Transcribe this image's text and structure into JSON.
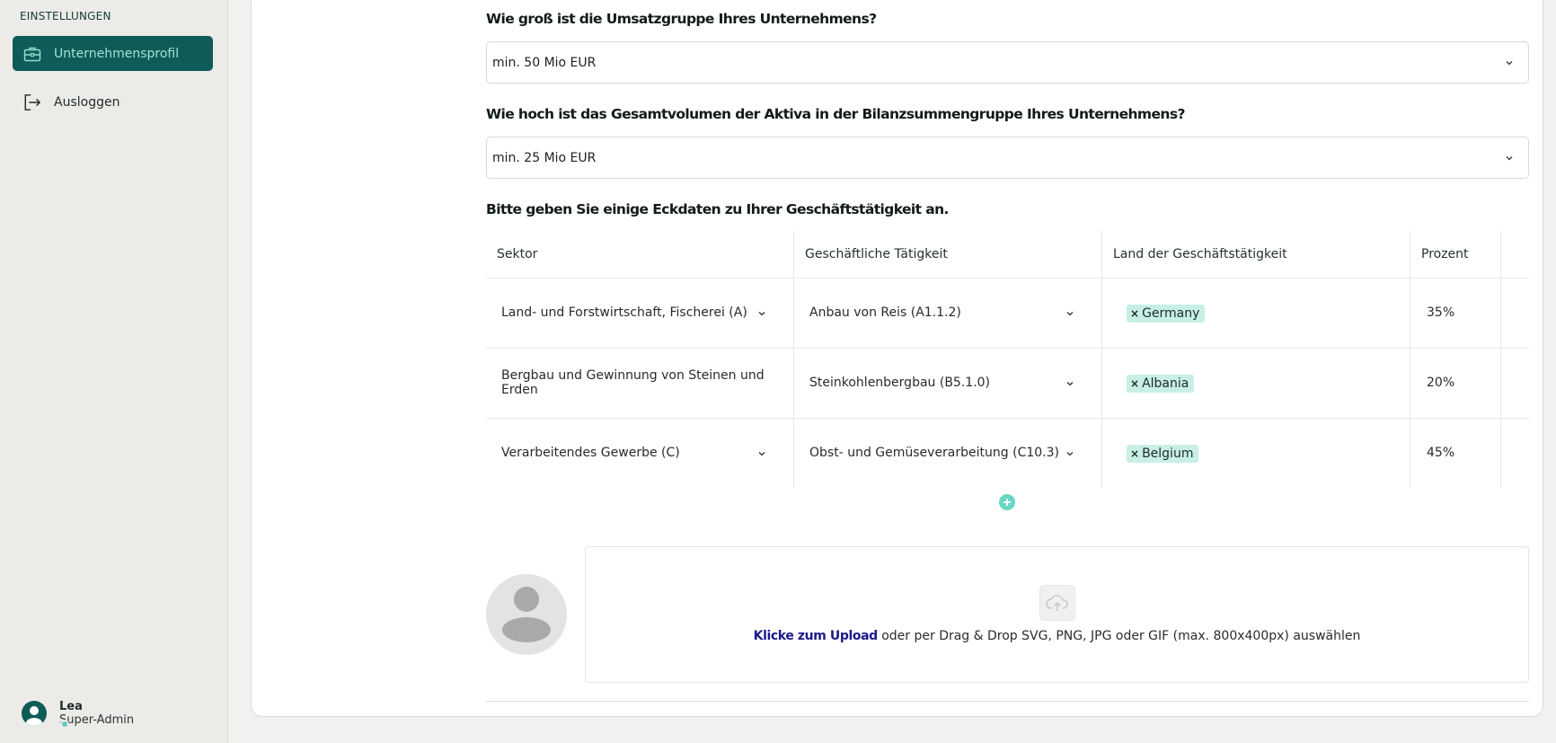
{
  "sidebar": {
    "section_title": "EINSTELLUNGEN",
    "items": [
      {
        "label": "Unternehmensprofil",
        "icon": "briefcase-icon",
        "active": true
      },
      {
        "label": "Ausloggen",
        "icon": "logout-icon",
        "active": false
      }
    ],
    "user": {
      "name": "Lea",
      "role": "Super-Admin"
    }
  },
  "form": {
    "q1": {
      "label": "Wie groß ist die Umsatzgruppe Ihres Unternehmens?",
      "value": "min. 50 Mio EUR"
    },
    "q2": {
      "label": "Wie hoch ist das Gesamtvolumen der Aktiva in der Bilanzsummengruppe Ihres Unternehmens?",
      "value": "min. 25 Mio EUR"
    },
    "q3": {
      "label": "Bitte geben Sie einige Eckdaten zu Ihrer Geschäftstätigkeit an."
    }
  },
  "table": {
    "headers": [
      "Sektor",
      "Geschäftliche Tätigkeit",
      "Land der Geschäftstätigkeit",
      "Prozent"
    ],
    "rows": [
      {
        "sector": "Land- und Forstwirtschaft, Fischerei (A)",
        "activity": "Anbau von Reis (A1.1.2)",
        "country": "Germany",
        "percent": "35%"
      },
      {
        "sector": "Bergbau und Gewinnung von Steinen und Erden",
        "activity": "Steinkohlenbergbau (B5.1.0)",
        "country": "Albania",
        "percent": "20%"
      },
      {
        "sector": "Verarbeitendes Gewerbe (C)",
        "activity": "Obst- und Gemüseverarbeitung (C10.3)",
        "country": "Belgium",
        "percent": "45%"
      }
    ],
    "chip_remove": "×"
  },
  "upload": {
    "link_label": "Klicke zum Upload",
    "hint": " oder per Drag & Drop SVG, PNG, JPG oder GIF (max. 800x400px) auswählen"
  },
  "colors": {
    "accent": "#0f5b57",
    "accent_light": "#68d7c6",
    "chip": "#c8efe6"
  }
}
